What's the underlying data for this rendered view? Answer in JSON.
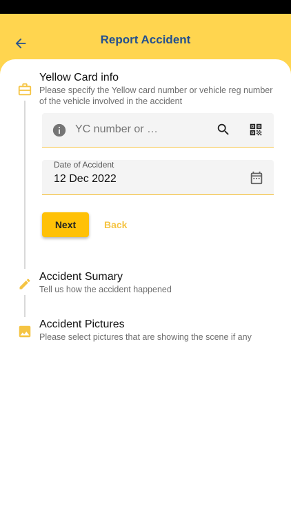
{
  "header": {
    "title": "Report Accident",
    "back_icon": "arrow-left-icon",
    "background": "#FFD54F",
    "title_color": "#24508f"
  },
  "steps": [
    {
      "icon": "briefcase-icon",
      "title": "Yellow Card info",
      "subtitle": "Please specify the Yellow card number or vehicle reg number of the vehicle involved in the accident"
    },
    {
      "icon": "pencil-icon",
      "title": "Accident Sumary",
      "subtitle": "Tell us how the accident happened"
    },
    {
      "icon": "image-icon",
      "title": "Accident Pictures",
      "subtitle": "Please select pictures that are showing the scene if any"
    }
  ],
  "form": {
    "yc_placeholder": "YC number or …",
    "date_label": "Date of Accident",
    "date_value": "12 Dec 2022",
    "next_label": "Next",
    "back_label": "Back"
  },
  "colors": {
    "accent": "#FFC107",
    "step_icon": "#F5C443"
  }
}
